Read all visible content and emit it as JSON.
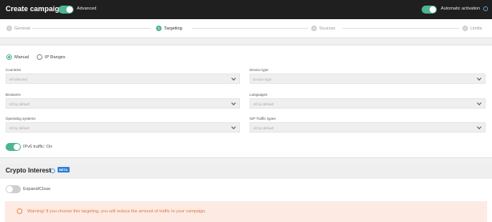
{
  "header": {
    "title": "Create campaign",
    "advanced_label": "Advanced",
    "advanced_on": true,
    "auto_activation_label": "Automatic activation",
    "auto_activation_on": true
  },
  "steps": [
    {
      "num": "1",
      "label": "General",
      "active": false
    },
    {
      "num": "2",
      "label": "Targeting",
      "active": true
    },
    {
      "num": "3",
      "label": "Sources",
      "active": false
    },
    {
      "num": "4",
      "label": "Limits",
      "active": false
    }
  ],
  "targeting": {
    "mode_options": [
      {
        "label": "Manual",
        "selected": true
      },
      {
        "label": "IP Ranges",
        "selected": false
      }
    ],
    "fields": [
      {
        "label": "Countries",
        "value": "All selected"
      },
      {
        "label": "Device type",
        "value": "Device type"
      },
      {
        "label": "Browsers",
        "value": "All by default"
      },
      {
        "label": "Languages",
        "value": "All by default"
      },
      {
        "label": "Operating systems",
        "value": "All by default"
      },
      {
        "label": "ISP Traffic types",
        "value": "All by default"
      }
    ],
    "ipv6_label": "IPv6 traffic: On",
    "ipv6_on": true
  },
  "crypto": {
    "title": "Crypto Interest",
    "badge": "BETA",
    "expand_label": "Expand/Close",
    "expand_on": false,
    "warning": "Warning! If you choose this targeting, you will reduce the amount of traffic to your campaign."
  },
  "colors": {
    "accent": "#4db58f",
    "topbar": "#1f1f1f",
    "warning_bg": "#fdebe3",
    "warning_text": "#e07a3f",
    "beta_badge": "#2f7fd1"
  }
}
